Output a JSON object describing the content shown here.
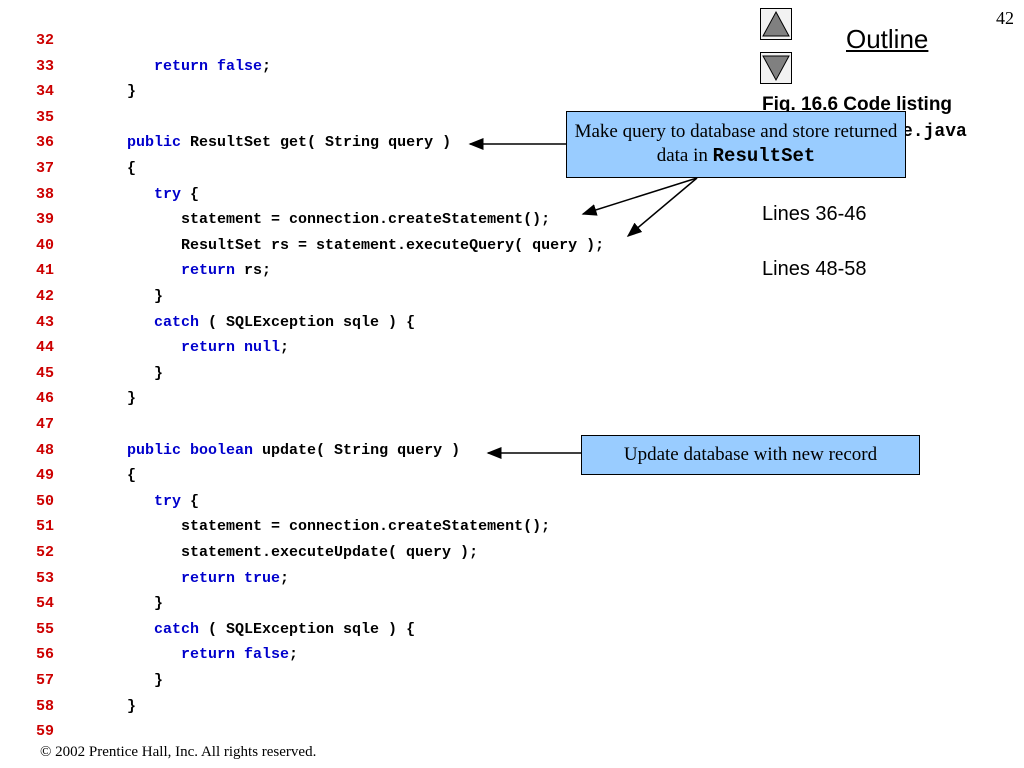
{
  "page_number": "42",
  "outline": {
    "title": "Outline",
    "up_icon": "triangle-up-icon",
    "down_icon": "triangle-down-icon"
  },
  "figure": {
    "caption_prefix": "Fig. 16.6   Code listing",
    "caption_file_partial": "e.java"
  },
  "line_refs": [
    "Lines 36-46",
    "Lines 48-58"
  ],
  "callouts": {
    "query": {
      "text": "Make query to database and store returned data in",
      "code": "ResultSet"
    },
    "update": {
      "text": "Update database with new record"
    }
  },
  "code_lines": [
    {
      "n": "32",
      "indent": "",
      "parts": []
    },
    {
      "n": "33",
      "indent": "      ",
      "parts": [
        {
          "k": "return false",
          "kw": true
        },
        {
          "k": ";",
          "kw": false
        }
      ]
    },
    {
      "n": "34",
      "indent": "   ",
      "parts": [
        {
          "k": "}",
          "kw": false
        }
      ]
    },
    {
      "n": "35",
      "indent": "",
      "parts": []
    },
    {
      "n": "36",
      "indent": "   ",
      "parts": [
        {
          "k": "public",
          "kw": true
        },
        {
          "k": " ResultSet get( String query )",
          "kw": false
        }
      ]
    },
    {
      "n": "37",
      "indent": "   ",
      "parts": [
        {
          "k": "{",
          "kw": false
        }
      ]
    },
    {
      "n": "38",
      "indent": "      ",
      "parts": [
        {
          "k": "try",
          "kw": true
        },
        {
          "k": " {",
          "kw": false
        }
      ]
    },
    {
      "n": "39",
      "indent": "         ",
      "parts": [
        {
          "k": "statement = connection.createStatement();",
          "kw": false
        }
      ]
    },
    {
      "n": "40",
      "indent": "         ",
      "parts": [
        {
          "k": "ResultSet rs = statement.executeQuery( query );",
          "kw": false
        }
      ]
    },
    {
      "n": "41",
      "indent": "         ",
      "parts": [
        {
          "k": "return",
          "kw": true
        },
        {
          "k": " rs;",
          "kw": false
        }
      ]
    },
    {
      "n": "42",
      "indent": "      ",
      "parts": [
        {
          "k": "}",
          "kw": false
        }
      ]
    },
    {
      "n": "43",
      "indent": "      ",
      "parts": [
        {
          "k": "catch",
          "kw": true
        },
        {
          "k": " ( SQLException sqle ) {",
          "kw": false
        }
      ]
    },
    {
      "n": "44",
      "indent": "         ",
      "parts": [
        {
          "k": "return null",
          "kw": true
        },
        {
          "k": ";",
          "kw": false
        }
      ]
    },
    {
      "n": "45",
      "indent": "      ",
      "parts": [
        {
          "k": "}",
          "kw": false
        }
      ]
    },
    {
      "n": "46",
      "indent": "   ",
      "parts": [
        {
          "k": "}",
          "kw": false
        }
      ]
    },
    {
      "n": "47",
      "indent": "",
      "parts": []
    },
    {
      "n": "48",
      "indent": "   ",
      "parts": [
        {
          "k": "public boolean",
          "kw": true
        },
        {
          "k": " update( String query )",
          "kw": false
        }
      ]
    },
    {
      "n": "49",
      "indent": "   ",
      "parts": [
        {
          "k": "{",
          "kw": false
        }
      ]
    },
    {
      "n": "50",
      "indent": "      ",
      "parts": [
        {
          "k": "try",
          "kw": true
        },
        {
          "k": " {",
          "kw": false
        }
      ]
    },
    {
      "n": "51",
      "indent": "         ",
      "parts": [
        {
          "k": "statement = connection.createStatement();",
          "kw": false
        }
      ]
    },
    {
      "n": "52",
      "indent": "         ",
      "parts": [
        {
          "k": "statement.executeUpdate( query );",
          "kw": false
        }
      ]
    },
    {
      "n": "53",
      "indent": "         ",
      "parts": [
        {
          "k": "return true",
          "kw": true
        },
        {
          "k": ";",
          "kw": false
        }
      ]
    },
    {
      "n": "54",
      "indent": "      ",
      "parts": [
        {
          "k": "}",
          "kw": false
        }
      ]
    },
    {
      "n": "55",
      "indent": "      ",
      "parts": [
        {
          "k": "catch",
          "kw": true
        },
        {
          "k": " ( SQLException sqle ) {",
          "kw": false
        }
      ]
    },
    {
      "n": "56",
      "indent": "         ",
      "parts": [
        {
          "k": "return false",
          "kw": true
        },
        {
          "k": ";",
          "kw": false
        }
      ]
    },
    {
      "n": "57",
      "indent": "      ",
      "parts": [
        {
          "k": "}",
          "kw": false
        }
      ]
    },
    {
      "n": "58",
      "indent": "   ",
      "parts": [
        {
          "k": "}",
          "kw": false
        }
      ]
    },
    {
      "n": "59",
      "indent": "",
      "parts": []
    }
  ],
  "copyright": "© 2002 Prentice Hall, Inc.  All rights reserved.",
  "colors": {
    "line_number": "#cc0000",
    "keyword": "#0000cc",
    "callout_fill": "#99ccff"
  }
}
